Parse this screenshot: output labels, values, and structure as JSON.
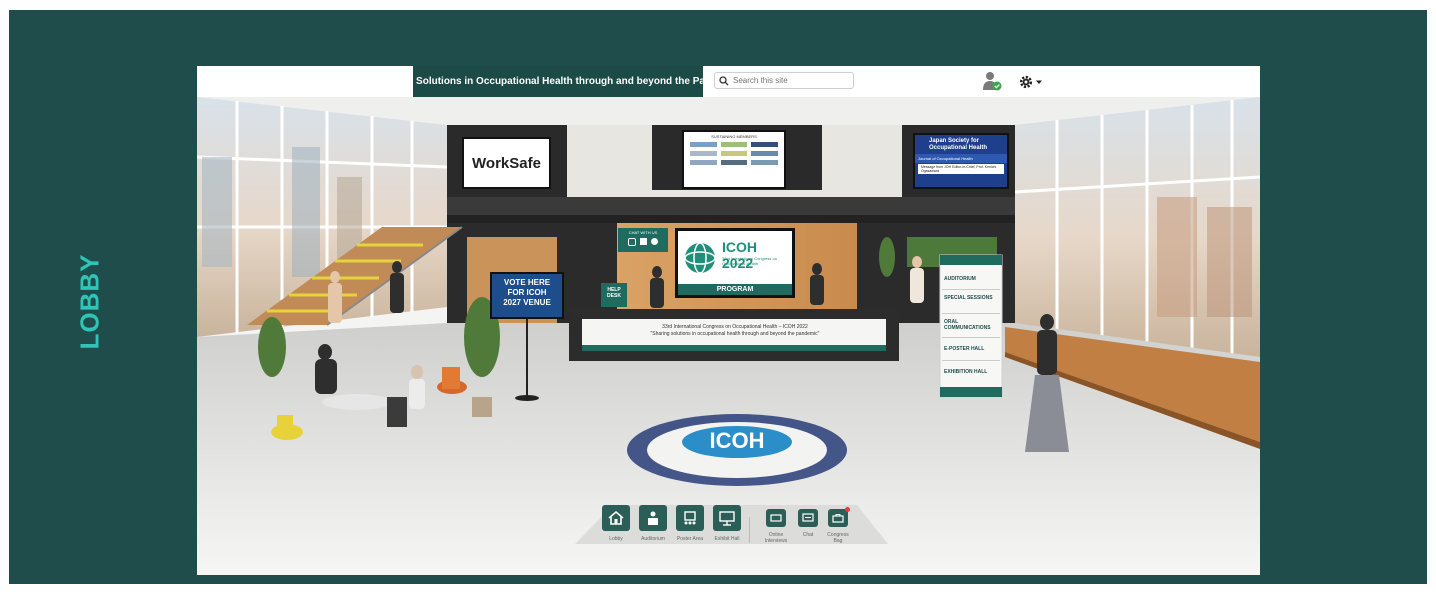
{
  "side_label": "LOBBY",
  "header": {
    "tagline": "Sharing Solutions in Occupational Health through and beyond the Pandemic",
    "search_placeholder": "Search this site"
  },
  "booths": {
    "worksafe_logo": "WorkSafe",
    "sponsors_title": "SUSTAINING MEMBERS",
    "jsoh_title": "Japan Society for Occupational Health",
    "jsoh_sub": "Journal of Occupational Health",
    "jsoh_msg": "Message from JOH Editor-in-Chief, Prof. Kenichi Ogasawara"
  },
  "chat_sign": {
    "title": "CHAT WITH US"
  },
  "program_screen": {
    "title": "ICOH 2022",
    "subtitle": "33rd International Congress on Occupational Health",
    "button": "PROGRAM"
  },
  "help_desk": "HELP DESK",
  "vote_sign": {
    "line1": "VOTE HERE",
    "line2": "FOR ICOH",
    "line3": "2027 VENUE"
  },
  "reception_banner": {
    "line1": "33rd International Congress on Occupational Health – ICOH 2022",
    "line2": "\"Sharing solutions in occupational health through and beyond the pandemic\""
  },
  "floor_logo": "ICOH",
  "directory": {
    "items": [
      "AUDITORIUM",
      "SPECIAL SESSIONS",
      "ORAL COMMUNICATIONS",
      "E-POSTER HALL",
      "EXHIBITION HALL"
    ]
  },
  "nav": {
    "lobby": "Lobby",
    "auditorium": "Auditorium",
    "poster_area": "Poster Area",
    "exhibit_hall": "Exhibit Hall",
    "online_interviews": "Online Interviews",
    "chat": "Chat",
    "congress_bag": "Congress Bag"
  },
  "colors": {
    "frame": "#1f4d4b",
    "accent": "#2ec4b6",
    "nav_button": "#2a5e56",
    "vote_sign": "#1e4d8c"
  }
}
